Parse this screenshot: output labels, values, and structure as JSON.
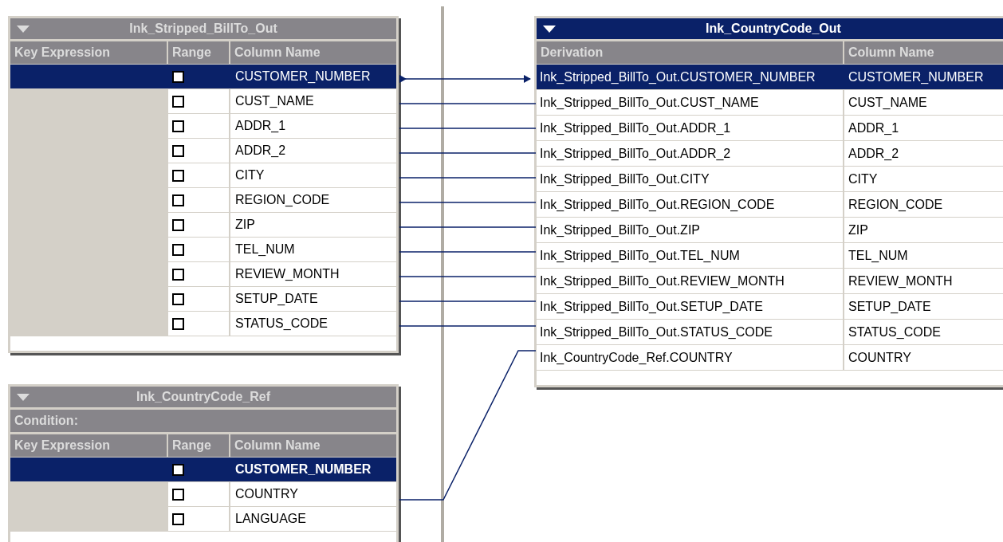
{
  "tables": [
    {
      "title": "Ink_Stripped_BillTo_Out",
      "active": false,
      "columns": [
        "Key Expression",
        "Range",
        "Column Name"
      ],
      "rows": [
        {
          "column_name": "CUSTOMER_NUMBER",
          "checked": false,
          "selected": true,
          "key": false
        },
        {
          "column_name": "CUST_NAME",
          "checked": false,
          "selected": false,
          "key": false
        },
        {
          "column_name": "ADDR_1",
          "checked": false,
          "selected": false,
          "key": false
        },
        {
          "column_name": "ADDR_2",
          "checked": false,
          "selected": false,
          "key": false
        },
        {
          "column_name": "CITY",
          "checked": false,
          "selected": false,
          "key": false
        },
        {
          "column_name": "REGION_CODE",
          "checked": false,
          "selected": false,
          "key": false
        },
        {
          "column_name": "ZIP",
          "checked": false,
          "selected": false,
          "key": false
        },
        {
          "column_name": "TEL_NUM",
          "checked": false,
          "selected": false,
          "key": false
        },
        {
          "column_name": "REVIEW_MONTH",
          "checked": false,
          "selected": false,
          "key": false
        },
        {
          "column_name": "SETUP_DATE",
          "checked": false,
          "selected": false,
          "key": false
        },
        {
          "column_name": "STATUS_CODE",
          "checked": false,
          "selected": false,
          "key": false
        }
      ]
    },
    {
      "title": "Ink_CountryCode_Ref",
      "active": false,
      "condition": "Condition:",
      "columns": [
        "Key Expression",
        "Range",
        "Column Name"
      ],
      "rows": [
        {
          "column_name": "CUSTOMER_NUMBER",
          "checked": false,
          "selected": true,
          "key": true
        },
        {
          "column_name": "COUNTRY",
          "checked": false,
          "selected": false,
          "key": false
        },
        {
          "column_name": "LANGUAGE",
          "checked": false,
          "selected": false,
          "key": false
        }
      ]
    }
  ],
  "output": {
    "title": "Ink_CountryCode_Out",
    "active": true,
    "columns": [
      "Derivation",
      "Column Name"
    ],
    "rows": [
      {
        "derivation": "Ink_Stripped_BillTo_Out.CUSTOMER_NUMBER",
        "column_name": "CUSTOMER_NUMBER",
        "selected": true
      },
      {
        "derivation": "Ink_Stripped_BillTo_Out.CUST_NAME",
        "column_name": "CUST_NAME",
        "selected": false
      },
      {
        "derivation": "Ink_Stripped_BillTo_Out.ADDR_1",
        "column_name": "ADDR_1",
        "selected": false
      },
      {
        "derivation": "Ink_Stripped_BillTo_Out.ADDR_2",
        "column_name": "ADDR_2",
        "selected": false
      },
      {
        "derivation": "Ink_Stripped_BillTo_Out.CITY",
        "column_name": "CITY",
        "selected": false
      },
      {
        "derivation": "Ink_Stripped_BillTo_Out.REGION_CODE",
        "column_name": "REGION_CODE",
        "selected": false
      },
      {
        "derivation": "Ink_Stripped_BillTo_Out.ZIP",
        "column_name": "ZIP",
        "selected": false
      },
      {
        "derivation": "Ink_Stripped_BillTo_Out.TEL_NUM",
        "column_name": "TEL_NUM",
        "selected": false
      },
      {
        "derivation": "Ink_Stripped_BillTo_Out.REVIEW_MONTH",
        "column_name": "REVIEW_MONTH",
        "selected": false
      },
      {
        "derivation": "Ink_Stripped_BillTo_Out.SETUP_DATE",
        "column_name": "SETUP_DATE",
        "selected": false
      },
      {
        "derivation": "Ink_Stripped_BillTo_Out.STATUS_CODE",
        "column_name": "STATUS_CODE",
        "selected": false
      },
      {
        "derivation": "Ink_CountryCode_Ref.COUNTRY",
        "column_name": "COUNTRY",
        "selected": false
      }
    ]
  }
}
